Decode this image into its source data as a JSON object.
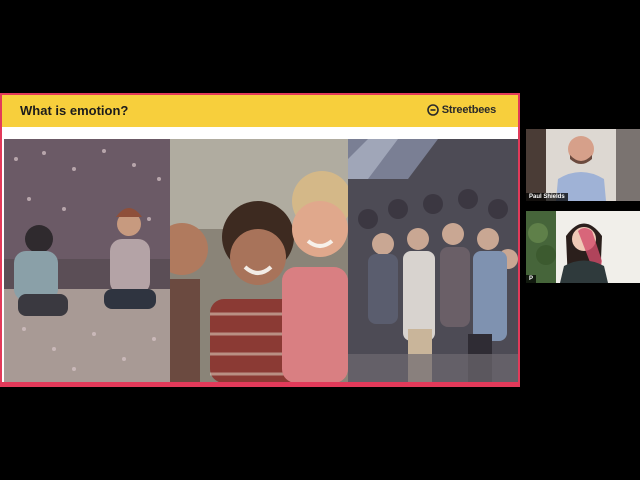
{
  "slide": {
    "title": "What is emotion?",
    "brand": "Streetbees",
    "colors": {
      "header": "#f7cf3c",
      "border": "#e23a5a"
    },
    "images": [
      {
        "name": "confetti-party-photo"
      },
      {
        "name": "smiling-children-photo"
      },
      {
        "name": "cheering-crowd-photo"
      }
    ]
  },
  "participants": [
    {
      "name": "Paul Shields"
    },
    {
      "name": "P"
    }
  ]
}
